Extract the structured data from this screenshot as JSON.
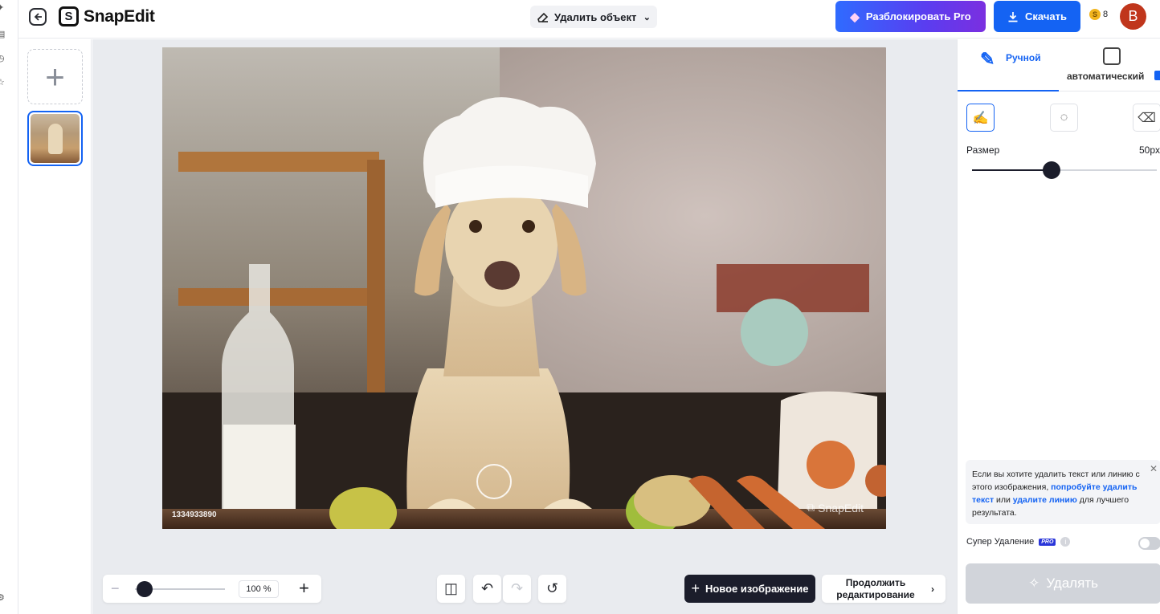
{
  "header": {
    "logo_text": "SnapEdit",
    "tool_select": "Удалить объект",
    "pro_button": "Разблокировать Pro",
    "download_button": "Скачать",
    "credits": "8",
    "avatar_initial": "B"
  },
  "canvas": {
    "watermark_id": "1334933890",
    "watermark_brand": "SnapEdit"
  },
  "bottom": {
    "zoom_value": "100 %",
    "zoom_level_percent": 100,
    "new_image_button": "Новое изображение",
    "continue_button": "Продолжить редактирование"
  },
  "panel": {
    "tab_manual": "Ручной",
    "tab_auto": "автоматический",
    "size_label": "Размер",
    "size_value": "50px",
    "size_level_fraction": 0.43,
    "tip_text_1": "Если вы хотите удалить текст или линию с этого изображения, ",
    "tip_link_1": "попробуйте удалить текст",
    "tip_text_2": " или ",
    "tip_link_2": "удалите линию",
    "tip_text_3": " для лучшего результата.",
    "super_erase_label": "Супер Удаление",
    "pro_badge": "PRO",
    "erase_button": "Удалять"
  },
  "colors": {
    "accent": "#1463f3",
    "dark": "#1b1d2b",
    "avatar": "#c0361c"
  }
}
